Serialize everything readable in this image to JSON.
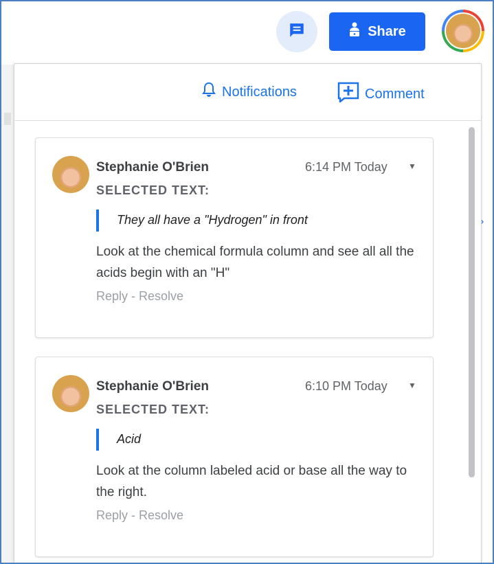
{
  "topbar": {
    "comments_icon": "comment-icon",
    "share_label": "Share",
    "share_icon": "person-lock-icon",
    "colors": {
      "share_bg": "#1a66f2",
      "comments_bg": "#e3ecfb"
    }
  },
  "panel": {
    "notifications_label": "Notifications",
    "comment_label": "Comment",
    "link_color": "#1a73e8"
  },
  "comments": [
    {
      "author": "Stephanie O'Brien",
      "time": "6:14 PM Today",
      "selected_label": "SELECTED TEXT:",
      "selected_text": "They all have a \"Hydrogen\" in front",
      "body": "Look at the chemical formula column and see all all the acids begin with an \"H\"",
      "reply": "Reply",
      "separator": " - ",
      "resolve": "Resolve"
    },
    {
      "author": "Stephanie O'Brien",
      "time": "6:10 PM Today",
      "selected_label": "SELECTED TEXT:",
      "selected_text": "Acid",
      "body": "Look at the column labeled acid or base all the way to the right.",
      "reply": "Reply",
      "separator": " - ",
      "resolve": "Resolve"
    }
  ]
}
